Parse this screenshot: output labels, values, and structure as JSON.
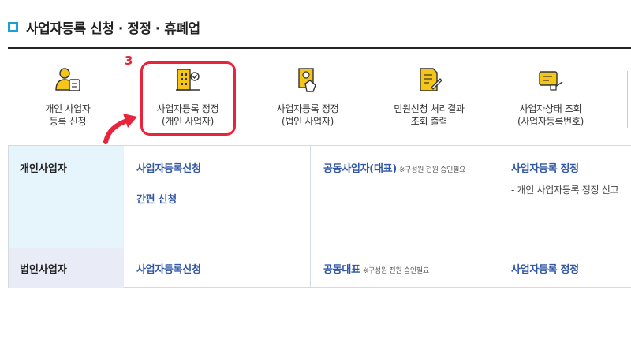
{
  "page": {
    "title": "사업자등록 신청 · 정정 · 휴폐업"
  },
  "step_marker": "3",
  "menu": [
    {
      "key": "individual-apply",
      "lines": [
        "개인 사업자",
        "등록 신청"
      ],
      "icon": "person-badge-icon"
    },
    {
      "key": "individual-correct",
      "lines": [
        "사업자등록 정정",
        "(개인 사업자)"
      ],
      "icon": "building-check-icon"
    },
    {
      "key": "corporate-correct",
      "lines": [
        "사업자등록 정정",
        "(법인 사업자)"
      ],
      "icon": "document-hand-icon"
    },
    {
      "key": "result-print",
      "lines": [
        "민원신청 처리결과",
        "조회 출력"
      ],
      "icon": "document-pen-icon"
    },
    {
      "key": "status-check",
      "lines": [
        "사업자상태 조회",
        "(사업자등록번호)"
      ],
      "icon": "card-search-icon"
    }
  ],
  "table": {
    "rows": [
      {
        "head": "개인사업자",
        "col1": {
          "link1": "사업자등록신청",
          "link2": "간편 신청"
        },
        "col2": {
          "link": "공동사업자(대표)",
          "note": "※구성원 전원 승인필요"
        },
        "col3": {
          "link": "사업자등록 정정",
          "desc": "- 개인 사업자등록 정정 신고"
        }
      },
      {
        "head": "법인사업자",
        "col1": {
          "link1": "사업자등록신청"
        },
        "col2": {
          "link": "공동대표",
          "note": "※구성원 전원 승인필요"
        },
        "col3": {
          "link": "사업자등록 정정"
        }
      }
    ]
  },
  "colors": {
    "accent_red": "#e8233a",
    "link_blue": "#3257a6",
    "icon_yellow": "#f5c518",
    "title_square": "#1e9ed6"
  }
}
